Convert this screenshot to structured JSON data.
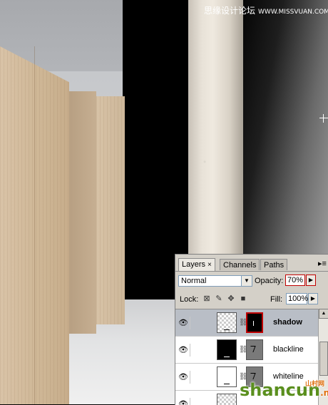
{
  "watermark": {
    "top_text": "思缘设计论坛",
    "top_url": "WWW.MISSVUAN.COM",
    "bottom_text": "shancun",
    "bottom_suffix": ".net",
    "bottom_cn": "山村网"
  },
  "layers_panel": {
    "tabs": [
      {
        "label": "Layers",
        "close": "×"
      },
      {
        "label": "Channels"
      },
      {
        "label": "Paths"
      }
    ],
    "menu_icon": "panel-menu-icon",
    "blend_mode": "Normal",
    "opacity_label": "Opacity:",
    "opacity_value": "70%",
    "lock_label": "Lock:",
    "fill_label": "Fill:",
    "fill_value": "100%",
    "layers": [
      {
        "name": "shadow",
        "selected": true,
        "thumb": "transparent",
        "mask": "black"
      },
      {
        "name": "blackline",
        "selected": false,
        "thumb": "black",
        "mask": "grey"
      },
      {
        "name": "whiteline",
        "selected": false,
        "thumb": "white",
        "mask": "grey"
      },
      {
        "name": "",
        "selected": false,
        "thumb": "transparent",
        "mask": "none"
      }
    ]
  },
  "colors": {
    "selected_row": "#b9bec6",
    "highlight_border": "#c00000",
    "panel_bg": "#d4d0c8"
  }
}
